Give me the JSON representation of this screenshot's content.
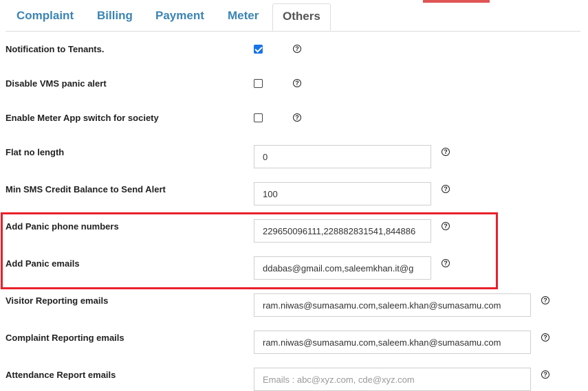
{
  "tabs": [
    {
      "label": "Complaint"
    },
    {
      "label": "Billing"
    },
    {
      "label": "Payment"
    },
    {
      "label": "Meter"
    },
    {
      "label": "Others"
    }
  ],
  "help_glyph": "?",
  "settings": {
    "notification_tenants": {
      "label": "Notification to Tenants.",
      "checked": true
    },
    "disable_vms_panic": {
      "label": "Disable VMS panic alert",
      "checked": false
    },
    "enable_meter_app": {
      "label": "Enable Meter App switch for society",
      "checked": false
    },
    "flat_no_length": {
      "label": "Flat no length",
      "value": "0"
    },
    "min_sms_credit": {
      "label": "Min SMS Credit Balance to Send Alert",
      "value": "100"
    },
    "panic_phone": {
      "label": "Add Panic phone numbers",
      "value": "229650096111,228882831541,844886"
    },
    "panic_emails": {
      "label": "Add Panic emails",
      "value": "ddabas@gmail.com,saleemkhan.it@g"
    },
    "visitor_emails": {
      "label": "Visitor Reporting emails",
      "value": "ram.niwas@sumasamu.com,saleem.khan@sumasamu.com"
    },
    "complaint_emails": {
      "label": "Complaint Reporting emails",
      "value": "ram.niwas@sumasamu.com,saleem.khan@sumasamu.com"
    },
    "attendance_emails": {
      "label": "Attendance Report emails",
      "value": "",
      "placeholder": "Emails : abc@xyz.com, cde@xyz.com"
    }
  },
  "colors": {
    "tab_link": "#3b84b5",
    "highlight_border": "#e8202a",
    "checkbox_checked": "#1a73e8"
  }
}
